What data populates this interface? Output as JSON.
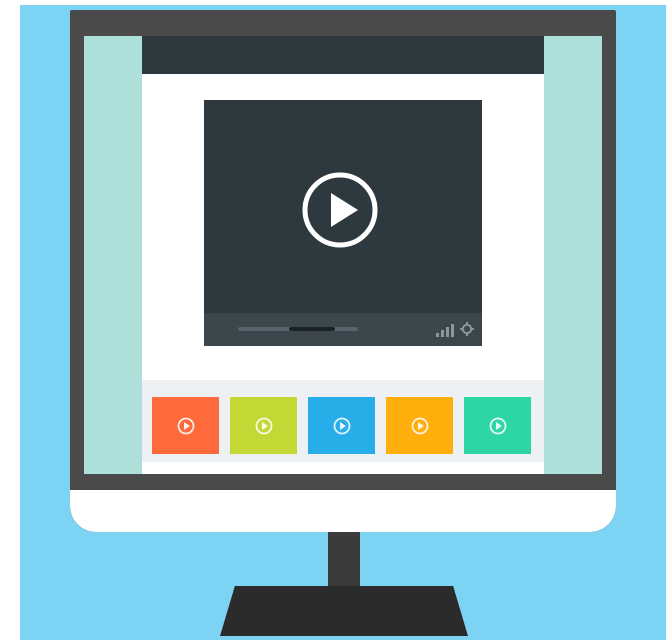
{
  "colors": {
    "background": "#7dd3f3",
    "monitor_frame": "#4a4a4a",
    "screen_side_panels": "#addfdb",
    "header_bar": "#2e393f",
    "player": "#2e393f",
    "player_controls": "#3b474d"
  },
  "player": {
    "icon": "play-circle-icon",
    "progress_fraction": 0.67,
    "status_icons": [
      "signal-icon",
      "gear-icon"
    ]
  },
  "thumbnails": [
    {
      "color": "#ff6a3d",
      "icon": "play-circle-icon"
    },
    {
      "color": "#c3d835",
      "icon": "play-circle-icon"
    },
    {
      "color": "#27aee9",
      "icon": "play-circle-icon"
    },
    {
      "color": "#ffae0c",
      "icon": "play-circle-icon"
    },
    {
      "color": "#2fd6a5",
      "icon": "play-circle-icon"
    }
  ]
}
